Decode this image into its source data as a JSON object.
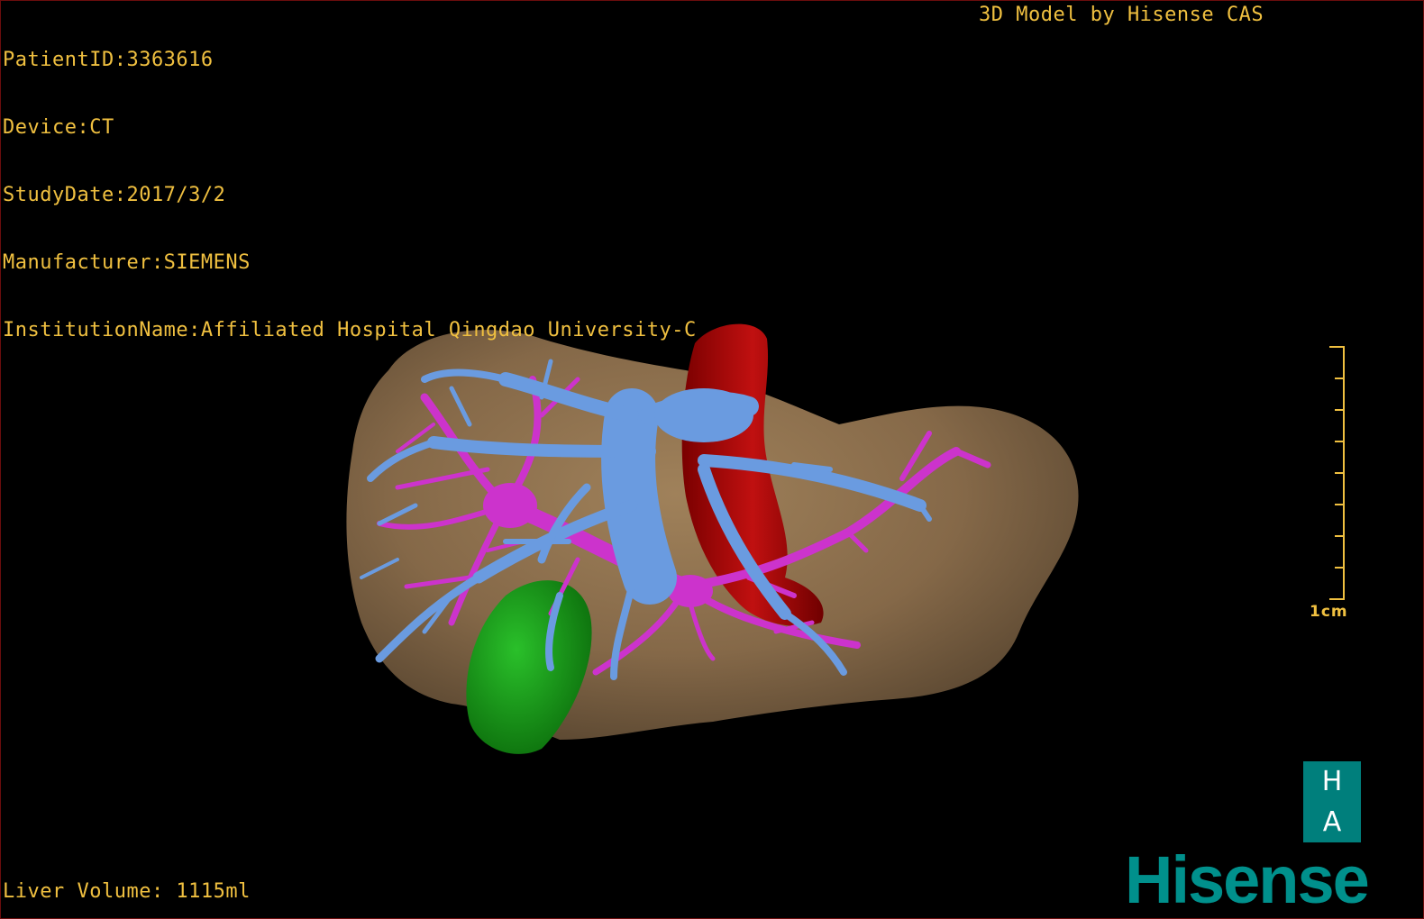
{
  "header": {
    "patient_id": "PatientID:3363616",
    "device": "Device:CT",
    "study_date": "StudyDate:2017/3/2",
    "manufacturer": "Manufacturer:SIEMENS",
    "institution": "InstitutionName:Affiliated Hospital Qingdao University-C"
  },
  "credit": "3D Model by Hisense CAS",
  "footer": {
    "liver_volume": "Liver Volume: 1115ml"
  },
  "scale": {
    "label": "1cm"
  },
  "logo": {
    "letter_top": "H",
    "letter_bottom": "A",
    "brand": "Hisense"
  },
  "colors": {
    "overlay_text": "#f0c040",
    "liver": "#8c6e4c",
    "portal_vein": "#6a9be0",
    "hepatic_vein": "#cc33cc",
    "artery_ivc": "#a00000",
    "gallbladder": "#1a9a1a",
    "brand": "#00908c"
  },
  "structures": [
    {
      "name": "liver"
    },
    {
      "name": "inferior-vena-cava"
    },
    {
      "name": "portal-vein"
    },
    {
      "name": "hepatic-vein"
    },
    {
      "name": "gallbladder"
    }
  ]
}
